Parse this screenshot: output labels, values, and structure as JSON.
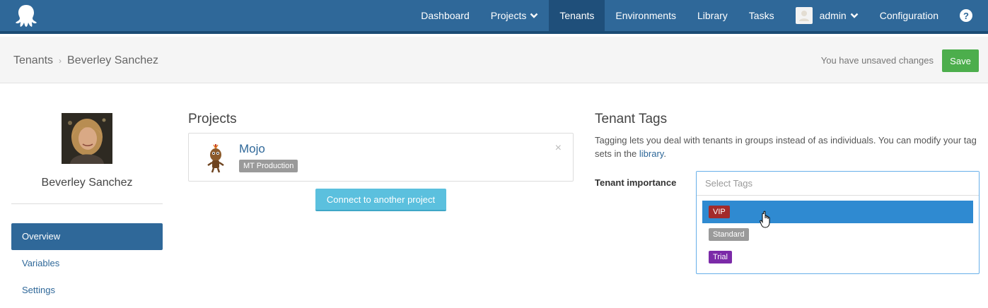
{
  "navbar": {
    "items": [
      {
        "label": "Dashboard"
      },
      {
        "label": "Projects"
      },
      {
        "label": "Tenants"
      },
      {
        "label": "Environments"
      },
      {
        "label": "Library"
      },
      {
        "label": "Tasks"
      },
      {
        "label": "admin"
      },
      {
        "label": "Configuration"
      }
    ],
    "help": "?",
    "active": "Tenants"
  },
  "header": {
    "breadcrumb_root": "Tenants",
    "breadcrumb_current": "Beverley Sanchez",
    "unsaved_text": "You have unsaved changes",
    "save_label": "Save"
  },
  "sidebar": {
    "tenant_name": "Beverley Sanchez",
    "links": [
      {
        "label": "Overview",
        "active": true
      },
      {
        "label": "Variables",
        "active": false
      },
      {
        "label": "Settings",
        "active": false
      }
    ]
  },
  "projects": {
    "title": "Projects",
    "items": [
      {
        "name": "Mojo",
        "environment": "MT Production"
      }
    ],
    "close_symbol": "×",
    "connect_label": "Connect to another project"
  },
  "tenant_tags": {
    "title": "Tenant Tags",
    "description_before": "Tagging lets you deal with tenants in groups instead of as individuals. You can modify your tag sets in the ",
    "description_link": "library",
    "description_after": ".",
    "field_label": "Tenant importance",
    "placeholder": "Select Tags",
    "options": [
      {
        "label": "VIP",
        "color": "#a32b2b",
        "highlighted": true
      },
      {
        "label": "Standard",
        "color": "#9a9a9a",
        "highlighted": false
      },
      {
        "label": "Trial",
        "color": "#7b2aa8",
        "highlighted": false
      }
    ]
  },
  "colors": {
    "navbar": "#2f6899",
    "save": "#4cae4c",
    "connect": "#5bc0de",
    "highlight": "#2f8ad1"
  }
}
